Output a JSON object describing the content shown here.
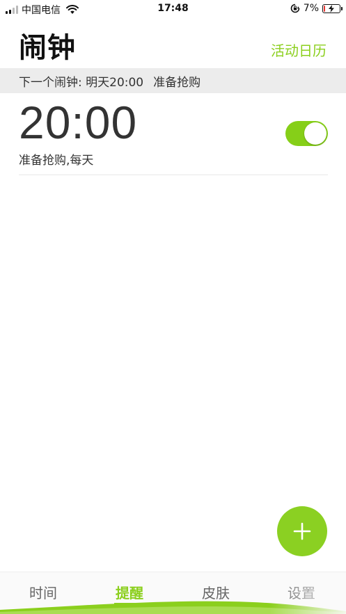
{
  "status_bar": {
    "carrier": "中国电信",
    "time": "17:48",
    "battery_percent": "7%",
    "battery_level": 0.07
  },
  "header": {
    "title": "闹钟",
    "calendar_link": "活动日历"
  },
  "next_alarm": {
    "prefix": "下一个闹钟: 明天20:00",
    "label": "准备抢购"
  },
  "alarms": [
    {
      "time": "20:00",
      "subtitle": "准备抢购,每天",
      "enabled": true
    }
  ],
  "fab": {
    "icon": "plus-icon"
  },
  "tabs": [
    {
      "label": "时间",
      "active": false
    },
    {
      "label": "提醒",
      "active": true
    },
    {
      "label": "皮肤",
      "active": false
    },
    {
      "label": "设置",
      "active": false
    }
  ],
  "colors": {
    "accent": "#8bcf1d",
    "toggle_on": "#86cf18",
    "banner_bg": "#ececec"
  }
}
